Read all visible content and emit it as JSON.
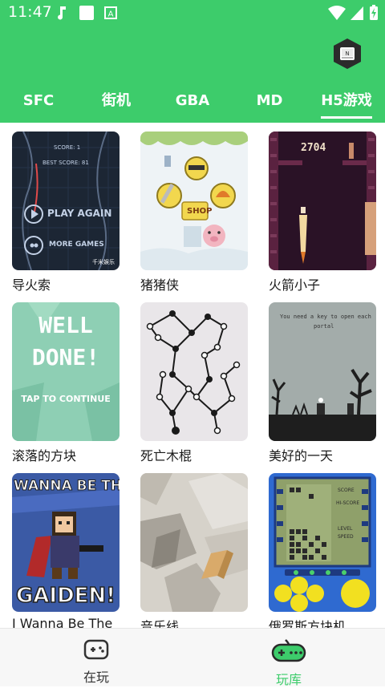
{
  "status_bar": {
    "time": "11:47"
  },
  "tabs": [
    {
      "label": "SFC"
    },
    {
      "label": "街机"
    },
    {
      "label": "GBA"
    },
    {
      "label": "MD"
    },
    {
      "label": "H5游戏"
    }
  ],
  "active_tab": "H5游戏",
  "games": [
    {
      "title": "导火索",
      "thumb_text": [
        "SCORE: 1",
        "BEST SCORE: 81",
        "PLAY AGAIN",
        "MORE GAMES",
        "千米娱乐"
      ]
    },
    {
      "title": "猪猪侠",
      "thumb_text": [
        "SHOP"
      ]
    },
    {
      "title": "火箭小子",
      "thumb_text": [
        "2704"
      ]
    },
    {
      "title": "滚落的方块",
      "thumb_text": [
        "WELL",
        "DONE!",
        "TAP TO CONTINUE"
      ]
    },
    {
      "title": "死亡木棍",
      "thumb_text": []
    },
    {
      "title": "美好的一天",
      "thumb_text": [
        "You need a key to open each",
        "portal"
      ]
    },
    {
      "title": "I Wanna Be The",
      "thumb_text": [
        "WANNA BE THE GU",
        "GAIDEN!"
      ]
    },
    {
      "title": "音乐线",
      "thumb_text": []
    },
    {
      "title": "俄罗斯方块机",
      "thumb_text": [
        "SCORE",
        "HI-SCORE",
        "LEVEL",
        "SPEED"
      ]
    }
  ],
  "bottom_nav": [
    {
      "label": "在玩"
    },
    {
      "label": "玩库"
    }
  ],
  "colors": {
    "header": "#3dcc6b",
    "active_nav": "#3dcc6b",
    "inactive_nav": "#333333"
  }
}
